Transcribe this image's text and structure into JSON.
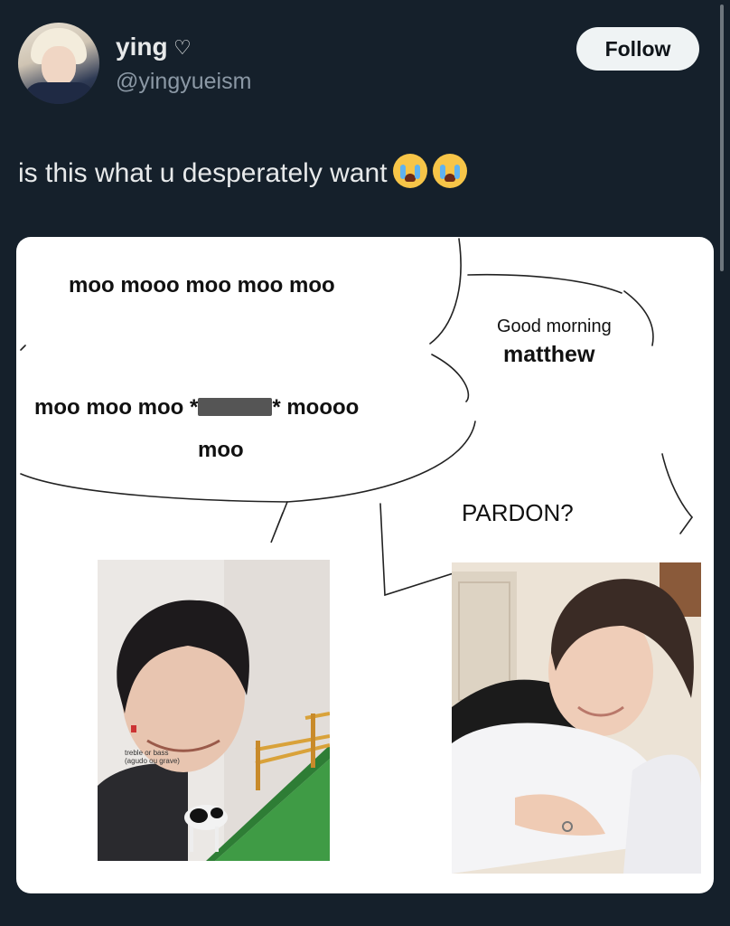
{
  "user": {
    "display_name": "ying",
    "handle": "@yingyueism",
    "follow_label": "Follow",
    "heart_glyph": "♡"
  },
  "tweet": {
    "text": "is this what u desperately want"
  },
  "meme": {
    "line1": "moo mooo moo moo moo",
    "line2a": "moo moo moo *",
    "line2b": "* moooo",
    "line3": "moo",
    "reply_line1": "Good morning",
    "reply_line2": "matthew",
    "pardon": "PARDON?",
    "overlay_line1": "treble or bass",
    "overlay_line2": "(agudo ou grave)"
  },
  "colors": {
    "background": "#15202b",
    "follow_button": "#eff3f4",
    "text_primary": "#e7e9ea",
    "text_secondary": "#8b98a5"
  }
}
